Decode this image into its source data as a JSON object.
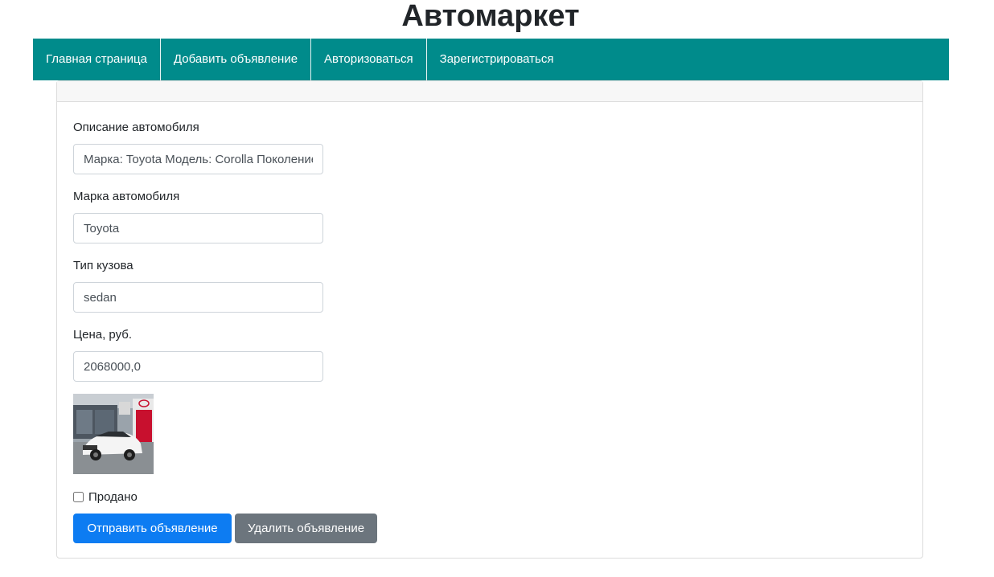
{
  "site": {
    "title": "Автомаркет"
  },
  "nav": {
    "items": [
      {
        "label": "Главная страница"
      },
      {
        "label": "Добавить объявление"
      },
      {
        "label": "Авторизоваться"
      },
      {
        "label": "Зарегистрироваться"
      }
    ]
  },
  "form": {
    "description": {
      "label": "Описание автомобиля",
      "value": "Марка: Toyota Модель: Corolla Поколение"
    },
    "brand": {
      "label": "Марка автомобиля",
      "value": "Toyota"
    },
    "body_type": {
      "label": "Тип кузова",
      "value": "sedan"
    },
    "price": {
      "label": "Цена, руб.",
      "value": "2068000,0"
    },
    "sold": {
      "label": "Продано",
      "checked": false
    },
    "submit_label": "Отправить объявление",
    "delete_label": "Удалить объявление"
  },
  "colors": {
    "navbar": "#008b8b",
    "primary": "#0d7cf2",
    "secondary": "#6c757d"
  }
}
